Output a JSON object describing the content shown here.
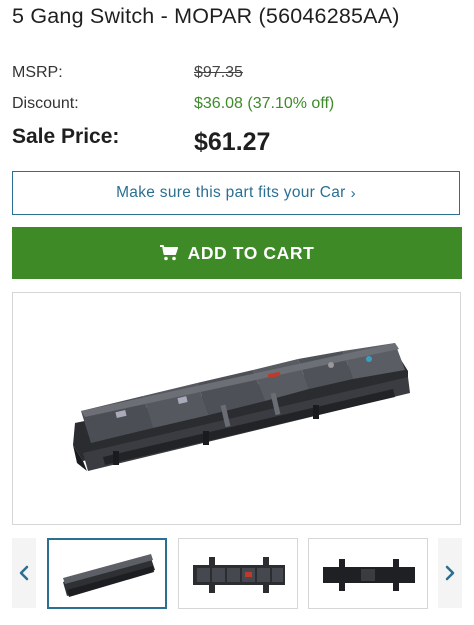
{
  "product": {
    "title": "5 Gang Switch - MOPAR (56046285AA)"
  },
  "pricing": {
    "msrp_label": "MSRP:",
    "msrp_value": "$97.35",
    "discount_label": "Discount:",
    "discount_value": "$36.08 (37.10% off)",
    "sale_label": "Sale Price:",
    "sale_value": "$61.27"
  },
  "actions": {
    "fit_label": "Make sure this part fits your Car",
    "fit_chevron": "›",
    "add_to_cart_label": "ADD TO CART"
  },
  "gallery": {
    "thumbnails": [
      "angled-view",
      "front-view",
      "back-view"
    ],
    "active_index": 0
  },
  "colors": {
    "accent_blue": "#2b6f92",
    "cart_green": "#3e8a27",
    "discount_green": "#3f8a2a"
  }
}
